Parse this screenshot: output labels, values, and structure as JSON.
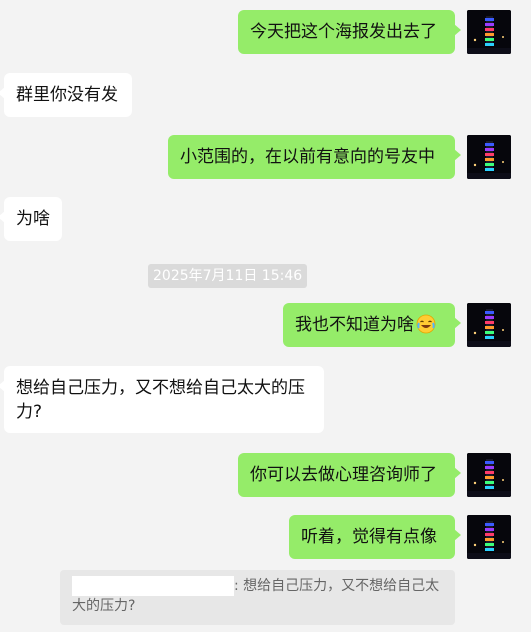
{
  "messages": [
    {
      "side": "mine",
      "text": "今天把这个海报发出去了"
    },
    {
      "side": "theirs",
      "text": "群里你没有发"
    },
    {
      "side": "mine",
      "text": "小范围的，在以前有意向的号友中"
    },
    {
      "side": "theirs",
      "text": "为啥"
    },
    {
      "side": "mine",
      "text": "我也不知道为啥",
      "emoji": "laughing-crying-emoji"
    },
    {
      "side": "theirs",
      "text": "想给自己压力，又不想给自己太大的压力?"
    },
    {
      "side": "mine",
      "text": "你可以去做心理咨询师了"
    },
    {
      "side": "mine",
      "text": "听着，觉得有点像"
    }
  ],
  "timestamp": "2025年7月11日 15:46",
  "quote": {
    "text": ": 想给自己压力，又不想给自己太大的压力?"
  },
  "colors": {
    "background": "#f3f3f3",
    "mine_bubble": "#95ec69",
    "theirs_bubble": "#ffffff",
    "timestamp_bg": "#dadada",
    "quote_bg": "#e7e7e7"
  },
  "icons": {
    "avatar": "tower-lights-avatar-icon",
    "emoji": "laughing-crying-emoji"
  }
}
